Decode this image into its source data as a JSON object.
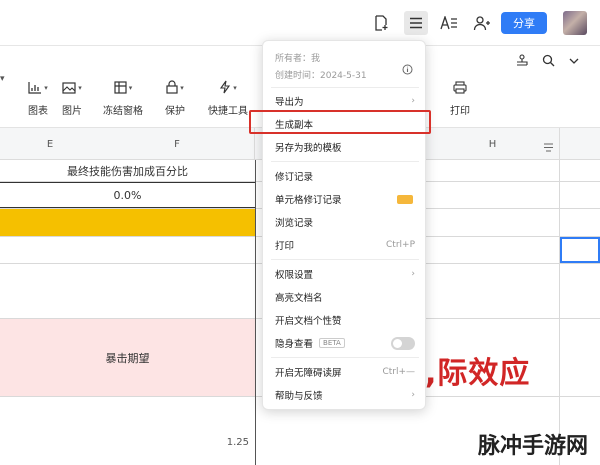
{
  "topbar": {
    "share_label": "分享",
    "icons": [
      "doc-plus-icon",
      "menu-icon",
      "font-icon",
      "user-share-icon"
    ]
  },
  "toolbar": {
    "items": [
      {
        "label": "图表",
        "icon": "chart-icon"
      },
      {
        "label": "图片",
        "icon": "image-icon"
      },
      {
        "label": "冻结窗格",
        "icon": "freeze-icon"
      },
      {
        "label": "保护",
        "icon": "lock-icon"
      },
      {
        "label": "快捷工具",
        "icon": "lightning-icon"
      },
      {
        "label": "打印",
        "icon": "printer-icon"
      }
    ]
  },
  "grid": {
    "columns": [
      "E",
      "F",
      "H"
    ],
    "header_cell": "最终技能伤害加成百分比",
    "value_cell": "0.0%",
    "expect_cell": "暴击期望",
    "bottom_value": "1.25",
    "colors": {
      "yellow": "#f5c000",
      "pink": "#fde4e4"
    }
  },
  "menu": {
    "owner": "所有者：我",
    "created": "创建时间：2024-5-31",
    "items": {
      "export": "导出为",
      "copy": "生成副本",
      "save_template": "另存为我的模板",
      "revision": "修订记录",
      "cell_revision": "单元格修订记录",
      "browse": "浏览记录",
      "print": "打印",
      "print_shortcut": "Ctrl+P",
      "permission": "权限设置",
      "highlight_name": "高亮文档名",
      "like": "开启文档个性赞",
      "incognito": "隐身查看",
      "beta": "BETA",
      "accessible": "开启无障碍读屏",
      "accessible_shortcut": "Ctrl+—",
      "help": "帮助与反馈"
    }
  },
  "overlay": {
    "red_text": ",际效应",
    "watermark": "脉冲手游网"
  }
}
